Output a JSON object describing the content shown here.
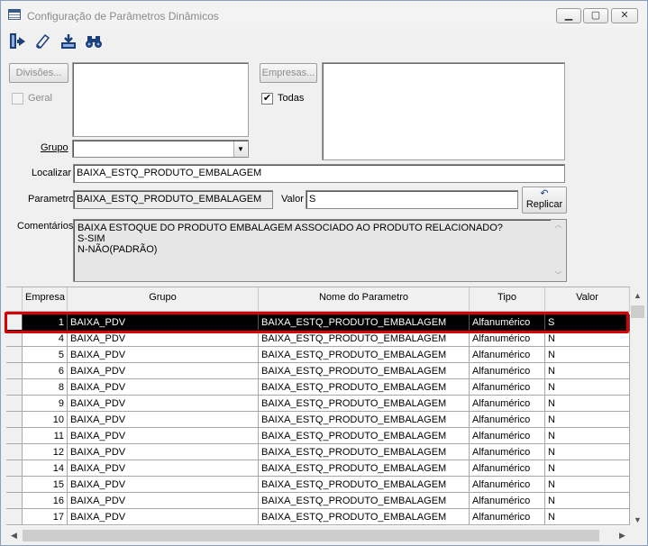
{
  "window": {
    "title": "Configuração de Parâmetros Dinâmicos"
  },
  "title_buttons": {
    "minimize": "▁",
    "maximize": "▢",
    "close": "✕"
  },
  "toolbar": {
    "icons": [
      "exit-icon",
      "eraser-icon",
      "save-icon",
      "binoculars-icon"
    ]
  },
  "filters": {
    "divisoes_button": "Divisões...",
    "geral_label": "Geral",
    "empresas_button": "Empresas...",
    "todas_label": "Todas",
    "todas_checked": "✔",
    "grupo_label": "Grupo",
    "grupo_value": "",
    "localizar_label": "Localizar",
    "localizar_value": "BAIXA_ESTQ_PRODUTO_EMBALAGEM"
  },
  "parametro": {
    "label": "Parametro",
    "value": "BAIXA_ESTQ_PRODUTO_EMBALAGEM",
    "valor_label": "Valor",
    "valor_value": "S",
    "replicar_button": "Replicar"
  },
  "comentarios": {
    "label": "Comentários",
    "lines": [
      "BAIXA ESTOQUE DO PRODUTO EMBALAGEM ASSOCIADO AO PRODUTO RELACIONADO?",
      "S-SIM",
      "N-NÃO(PADRÃO)"
    ]
  },
  "table": {
    "columns": [
      "Empresa",
      "Grupo",
      "Nome do Parametro",
      "Tipo",
      "Valor"
    ],
    "rows": [
      [
        "1",
        "BAIXA_PDV",
        "BAIXA_ESTQ_PRODUTO_EMBALAGEM",
        "Alfanumérico",
        "S"
      ],
      [
        "4",
        "BAIXA_PDV",
        "BAIXA_ESTQ_PRODUTO_EMBALAGEM",
        "Alfanumérico",
        "N"
      ],
      [
        "5",
        "BAIXA_PDV",
        "BAIXA_ESTQ_PRODUTO_EMBALAGEM",
        "Alfanumérico",
        "N"
      ],
      [
        "6",
        "BAIXA_PDV",
        "BAIXA_ESTQ_PRODUTO_EMBALAGEM",
        "Alfanumérico",
        "N"
      ],
      [
        "8",
        "BAIXA_PDV",
        "BAIXA_ESTQ_PRODUTO_EMBALAGEM",
        "Alfanumérico",
        "N"
      ],
      [
        "9",
        "BAIXA_PDV",
        "BAIXA_ESTQ_PRODUTO_EMBALAGEM",
        "Alfanumérico",
        "N"
      ],
      [
        "10",
        "BAIXA_PDV",
        "BAIXA_ESTQ_PRODUTO_EMBALAGEM",
        "Alfanumérico",
        "N"
      ],
      [
        "11",
        "BAIXA_PDV",
        "BAIXA_ESTQ_PRODUTO_EMBALAGEM",
        "Alfanumérico",
        "N"
      ],
      [
        "12",
        "BAIXA_PDV",
        "BAIXA_ESTQ_PRODUTO_EMBALAGEM",
        "Alfanumérico",
        "N"
      ],
      [
        "14",
        "BAIXA_PDV",
        "BAIXA_ESTQ_PRODUTO_EMBALAGEM",
        "Alfanumérico",
        "N"
      ],
      [
        "15",
        "BAIXA_PDV",
        "BAIXA_ESTQ_PRODUTO_EMBALAGEM",
        "Alfanumérico",
        "N"
      ],
      [
        "16",
        "BAIXA_PDV",
        "BAIXA_ESTQ_PRODUTO_EMBALAGEM",
        "Alfanumérico",
        "N"
      ],
      [
        "17",
        "BAIXA_PDV",
        "BAIXA_ESTQ_PRODUTO_EMBALAGEM",
        "Alfanumérico",
        "N"
      ]
    ],
    "selected_row": 0
  },
  "colors": {
    "selection": "#000000",
    "highlight_border": "#d80000"
  }
}
